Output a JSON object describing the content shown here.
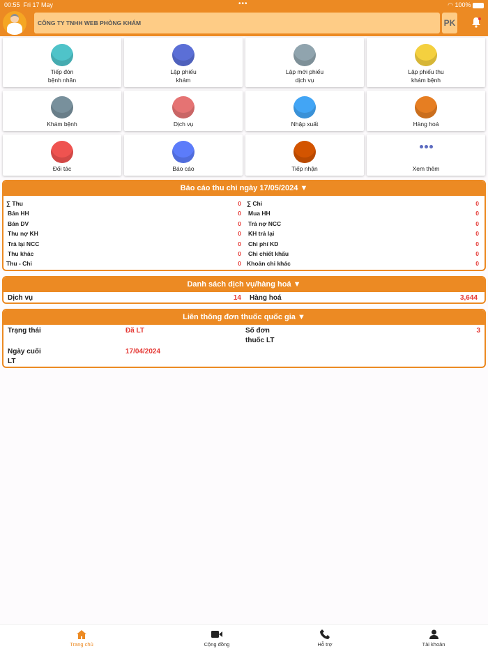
{
  "status": {
    "time": "00:55",
    "date": "Fri 17 May",
    "battery": "100%"
  },
  "header": {
    "company": "CÔNG TY TNHH WEB PHÒNG KHÁM",
    "pk": "PK"
  },
  "tiles": [
    {
      "label": "Tiếp đón\nbệnh nhân",
      "icon": "welcome-icon",
      "color": "#4fc3c9"
    },
    {
      "label": "Lập phiếu\nkhám",
      "icon": "clipboard-icon",
      "color": "#5b6fd6"
    },
    {
      "label": "Lập mới phiếu\ndịch vụ",
      "icon": "hospital-icon",
      "color": "#90a4ae"
    },
    {
      "label": "Lập phiếu thu\nkhám bệnh",
      "icon": "receipt-icon",
      "color": "#f4d03f"
    },
    {
      "label": "Khám bệnh",
      "icon": "monitor-icon",
      "color": "#78909c"
    },
    {
      "label": "Dịch vụ",
      "icon": "service-icon",
      "color": "#e57373"
    },
    {
      "label": "Nhập xuất",
      "icon": "import-export-icon",
      "color": "#42a5f5"
    },
    {
      "label": "Hàng hoá",
      "icon": "boxes-icon",
      "color": "#e67e22"
    },
    {
      "label": "Đối tác",
      "icon": "partner-icon",
      "color": "#ef5350"
    },
    {
      "label": "Báo cáo",
      "icon": "report-icon",
      "color": "#5c7cfa"
    },
    {
      "label": "Tiếp nhận",
      "icon": "receptionist-icon",
      "color": "#d35400"
    },
    {
      "label": "Xem thêm",
      "icon": "more-icon",
      "color": "#5c6bc0"
    }
  ],
  "report": {
    "title": "Báo cáo thu chi ngày 17/05/2024 ▼",
    "left": [
      [
        "∑ Thu",
        "0"
      ],
      [
        "Bán HH",
        "0"
      ],
      [
        "Bán DV",
        "0"
      ],
      [
        "Thu nợ KH",
        "0"
      ],
      [
        "Trả lại NCC",
        "0"
      ],
      [
        "Thu khác",
        "0"
      ],
      [
        "Thu - Chi",
        "0"
      ]
    ],
    "right": [
      [
        "∑ Chi",
        "0"
      ],
      [
        "Mua HH",
        "0"
      ],
      [
        "Trả nợ NCC",
        "0"
      ],
      [
        "KH trả lại",
        "0"
      ],
      [
        "Chi phí KD",
        "0"
      ],
      [
        "Chi chiết khấu",
        "0"
      ],
      [
        "Khoản chi khác",
        "0"
      ]
    ]
  },
  "catalog": {
    "title": "Danh sách dịch vụ/hàng hoá ▼",
    "service_label": "Dịch vụ",
    "service_value": "14",
    "goods_label": "Hàng hoá",
    "goods_value": "3,644"
  },
  "prescription": {
    "title": "Liên thông đơn thuốc quốc gia ▼",
    "status_label": "Trạng thái",
    "status_value": "Đã LT",
    "count_label": "Số đơn\nthuốc LT",
    "count_value": "3",
    "last_label": "Ngày cuối\nLT",
    "last_value": "17/04/2024"
  },
  "nav": [
    {
      "label": "Trang chủ"
    },
    {
      "label": "Cộng đồng"
    },
    {
      "label": "Hỗ trợ"
    },
    {
      "label": "Tài khoản"
    }
  ],
  "accent": "#ec8a23"
}
